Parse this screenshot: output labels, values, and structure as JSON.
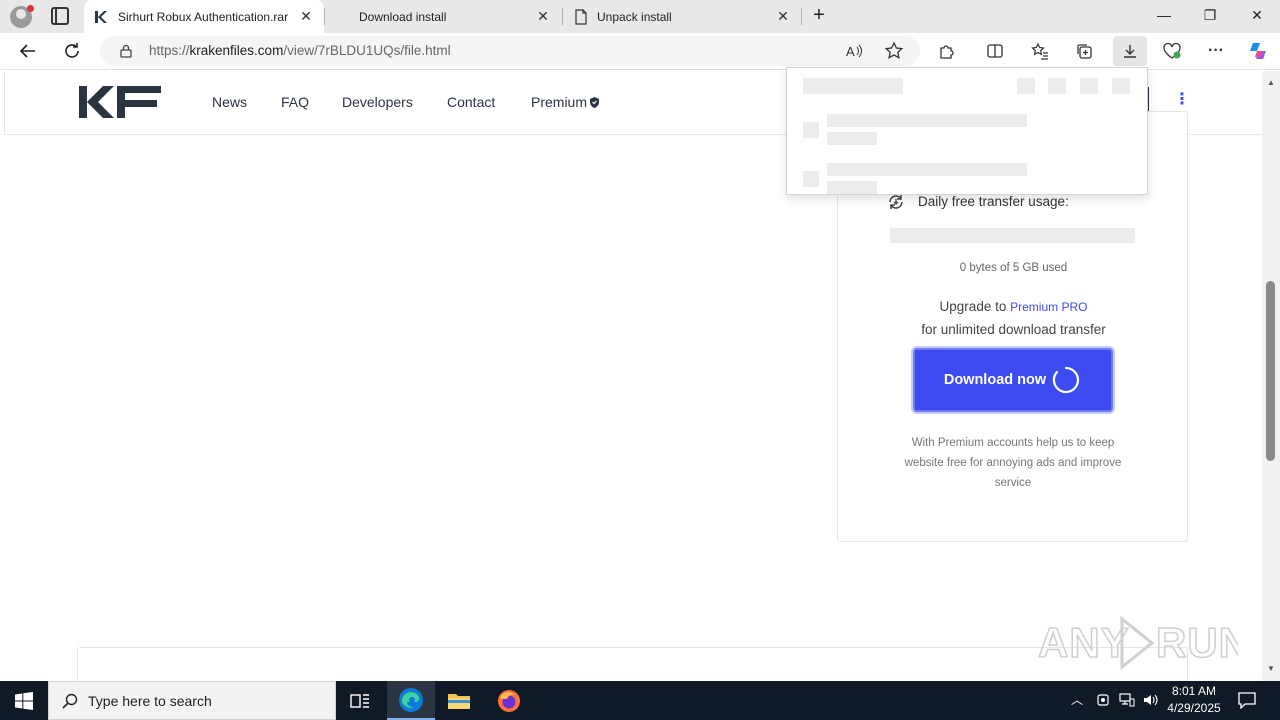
{
  "browser": {
    "tabs": [
      {
        "title": "Sirhurt Robux Authentication.rar",
        "active": true,
        "close": "✕"
      },
      {
        "title": "Download install",
        "active": false,
        "close": "✕"
      },
      {
        "title": "Unpack install",
        "active": false,
        "close": "✕"
      }
    ],
    "new_tab": "+",
    "window_controls": {
      "minimize": "—",
      "restore": "❐",
      "close": "✕"
    },
    "address_bar": {
      "url_prefix": "https://",
      "url_host": "krakenfiles.com",
      "url_path": "/view/7rBLDU1UQs/file.html"
    }
  },
  "site": {
    "logo_text": "KF",
    "nav": {
      "news": "News",
      "faq": "FAQ",
      "developers": "Developers",
      "contact": "Contact",
      "premium": "Premium"
    },
    "nav_menu": "⋮"
  },
  "download_card": {
    "usage_title": "Daily free transfer usage:",
    "usage_used_text": "0 bytes of 5 GB used",
    "usage_fraction": 0,
    "upgrade_text": "Upgrade to",
    "upgrade_link": "Premium PRO",
    "upgrade_text2": "for unlimited download transfer",
    "download_button": "Download now",
    "premium_note": "With Premium accounts help us to keep website free for annoying ads and improve service"
  },
  "watermark": "ANY RUN",
  "taskbar": {
    "search_placeholder": "Type here to search",
    "clock_time": "8:01 AM",
    "clock_date": "4/29/2025"
  },
  "colors": {
    "accent": "#3d4af0",
    "taskbar": "#101a26",
    "tab_strip": "#e8e8e8"
  }
}
